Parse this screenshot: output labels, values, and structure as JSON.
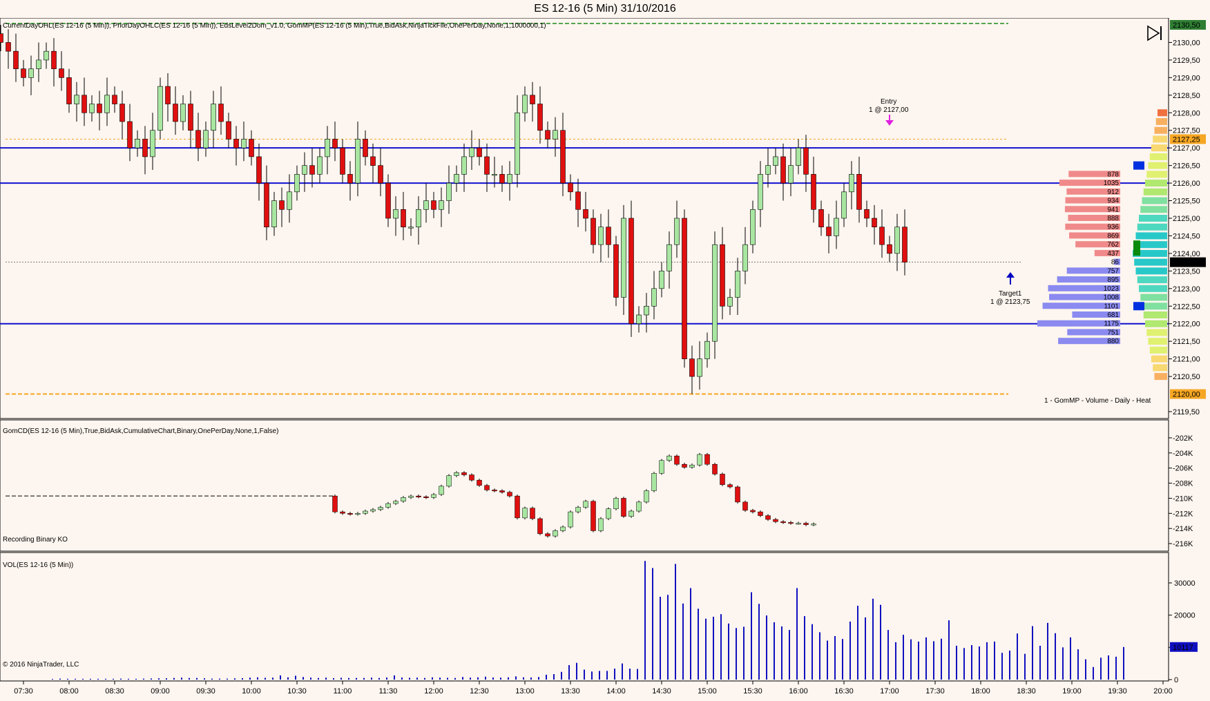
{
  "window": {
    "title": "ES 12-16 (5 Min)  31/10/2016"
  },
  "price_panel": {
    "indicator_label": "CurrentDayOHL(ES 12-16 (5 Min)); PriorDayOHLC(ES 12-16 (5 Min)); EdsLevel2Dom_v1.0; GomMP(ES 12-16 (5 Min),True,BidAsk,NinjaTickFile,OnePerDay,None,1,1000000,1)",
    "profile_label": "1 - GomMP - Volume - Daily - Heat",
    "entry_label": "Entry",
    "entry_detail": "1 @ 2127,00",
    "target_label": "Target1",
    "target_detail": "1 @ 2123,75",
    "y_ticks": [
      "2130,00",
      "2129,50",
      "2129,00",
      "2128,50",
      "2128,00",
      "2127,50",
      "2127,00",
      "2126,50",
      "2126,00",
      "2125,50",
      "2125,00",
      "2124,50",
      "2124,00",
      "2123,50",
      "2123,00",
      "2122,50",
      "2122,00",
      "2121,50",
      "2121,00",
      "2120,50",
      "2119,50"
    ],
    "price_flags": [
      {
        "label": "2130,50",
        "value": 2130.5,
        "color": "#2e7d32",
        "text_color": "#ffffff"
      },
      {
        "label": "2127,25",
        "value": 2127.25,
        "color": "#f5a623",
        "text_color": "#000000"
      },
      {
        "label": "2123,75",
        "value": 2123.75,
        "color": "#000000",
        "text_color": "#ffffff"
      },
      {
        "label": "2120,00",
        "value": 2120.0,
        "color": "#f5a623",
        "text_color": "#000000"
      }
    ],
    "ask_volumes": [
      "878",
      "1035",
      "912",
      "934",
      "941",
      "888",
      "936",
      "869",
      "762",
      "437"
    ],
    "bid_volumes": [
      "86",
      "757",
      "895",
      "1023",
      "1008",
      "1101",
      "681",
      "1175",
      "751",
      "880"
    ]
  },
  "cd_panel": {
    "indicator_label": "GomCD(ES 12-16 (5 Min),True,BidAsk,CumulativeChart,Binary,OnePerDay,None,1,False)",
    "status_label": "Recording Binary KO",
    "y_ticks": [
      "-202K",
      "-204K",
      "-206K",
      "-208K",
      "-210K",
      "-212K",
      "-214K",
      "-216K"
    ]
  },
  "vol_panel": {
    "indicator_label": "VOL(ES 12-16 (5 Min))",
    "copyright": "© 2016 NinjaTrader, LLC",
    "y_ticks": [
      "30000",
      "20000",
      "10000",
      "0"
    ],
    "last_value_label": "10117"
  },
  "x_axis": {
    "labels": [
      "07:30",
      "08:00",
      "08:30",
      "09:00",
      "09:30",
      "10:00",
      "10:30",
      "11:00",
      "11:30",
      "12:00",
      "12:30",
      "13:00",
      "13:30",
      "14:00",
      "14:30",
      "15:00",
      "15:30",
      "16:00",
      "16:30",
      "17:00",
      "17:30",
      "18:00",
      "18:30",
      "19:00",
      "19:30",
      "20:00"
    ]
  },
  "colors": {
    "up": "#a8e6a1",
    "down": "#e01010",
    "level_line": "#1010d0",
    "volume": "#1010c0",
    "background": "#fdf5ef"
  },
  "chart_data": [
    {
      "type": "candlestick",
      "title": "ES 12-16 (5 Min)  31/10/2016",
      "ylim": [
        2119.5,
        2130.5
      ],
      "levels": {
        "blue_lines": [
          2127.0,
          2126.0,
          2122.0
        ],
        "dashed_lines": [
          2127.25,
          2123.75
        ],
        "prior_day_high": 2130.5,
        "current_day_low": 2120.0
      },
      "start_time": "07:15",
      "x_labels": [
        "07:30",
        "08:00",
        "08:30",
        "09:00",
        "09:30",
        "10:00",
        "10:30",
        "11:00",
        "11:30",
        "12:00",
        "12:30",
        "13:00",
        "13:30",
        "14:00",
        "14:30",
        "15:00",
        "15:30",
        "16:00",
        "16:30",
        "17:00",
        "17:30",
        "18:00",
        "18:30",
        "19:00",
        "19:30",
        "20:00"
      ],
      "closes": [
        2130.0,
        2129.75,
        2129.25,
        2129.0,
        2129.25,
        2129.5,
        2129.75,
        2129.25,
        2129.0,
        2128.25,
        2128.5,
        2128.0,
        2128.25,
        2128.0,
        2128.5,
        2128.25,
        2127.75,
        2127.0,
        2127.25,
        2126.75,
        2127.5,
        2128.75,
        2128.25,
        2127.75,
        2128.25,
        2127.5,
        2127.0,
        2127.5,
        2128.25,
        2127.75,
        2127.25,
        2127.0,
        2127.25,
        2126.75,
        2126.0,
        2124.75,
        2125.5,
        2125.25,
        2125.75,
        2126.25,
        2126.5,
        2126.25,
        2126.75,
        2127.25,
        2127.0,
        2126.25,
        2126.0,
        2127.25,
        2126.75,
        2126.5,
        2126.0,
        2125.0,
        2125.25,
        2124.75,
        2124.75,
        2125.25,
        2125.5,
        2125.25,
        2125.5,
        2126.0,
        2126.25,
        2126.75,
        2127.0,
        2126.75,
        2126.25,
        2126.25,
        2126.0,
        2126.25,
        2128.0,
        2128.5,
        2128.25,
        2127.5,
        2127.25,
        2127.5,
        2126.0,
        2125.75,
        2125.25,
        2125.0,
        2124.25,
        2124.75,
        2124.25,
        2122.75,
        2125.0,
        2122.0,
        2122.25,
        2122.5,
        2123.0,
        2123.5,
        2124.25,
        2125.0,
        2121.0,
        2120.5,
        2121.0,
        2121.5,
        2124.25,
        2122.5,
        2122.75,
        2123.5,
        2124.25,
        2125.25,
        2126.25,
        2126.5,
        2126.75,
        2126.0,
        2126.5,
        2127.0,
        2126.25,
        2125.25,
        2124.75,
        2124.5,
        2125.0,
        2125.75,
        2126.25,
        2125.25,
        2125.0,
        2124.75,
        2124.25,
        2124.0,
        2124.75,
        2123.75
      ]
    },
    {
      "type": "candlestick",
      "title": "GomCD(ES 12-16 (5 Min),True,BidAsk,CumulativeChart,Binary,OnePerDay,None,1,False)",
      "ylim": [
        -217,
        -201
      ],
      "y_unit": "K",
      "flat_before_index": 44,
      "closes": [
        -211.8,
        -212.0,
        -212.1,
        -212.0,
        -211.7,
        -211.5,
        -211.2,
        -210.7,
        -210.4,
        -209.9,
        -209.7,
        -209.8,
        -209.9,
        -209.5,
        -208.4,
        -207.0,
        -206.6,
        -206.9,
        -207.6,
        -208.3,
        -208.9,
        -209.0,
        -209.2,
        -209.7,
        -212.6,
        -211.3,
        -212.7,
        -214.7,
        -215.0,
        -214.3,
        -213.8,
        -211.8,
        -211.2,
        -210.4,
        -214.3,
        -212.7,
        -211.4,
        -210.0,
        -212.4,
        -211.7,
        -210.5,
        -209.0,
        -206.7,
        -205.0,
        -204.4,
        -205.5,
        -205.9,
        -205.6,
        -204.2,
        -205.5,
        -206.8,
        -208.2,
        -208.5,
        -210.5,
        -211.6,
        -211.8,
        -212.3,
        -212.8,
        -213.1,
        -213.2,
        -213.3,
        -213.3,
        -213.5,
        -213.4
      ]
    },
    {
      "type": "bar",
      "title": "VOL(ES 12-16 (5 Min))",
      "ylim": [
        0,
        36000
      ],
      "values": [
        200,
        300,
        250,
        250,
        250,
        250,
        250,
        250,
        250,
        300,
        250,
        250,
        300,
        350,
        400,
        400,
        500,
        600,
        500,
        500,
        400,
        300,
        300,
        300,
        400,
        450,
        600,
        700,
        550,
        600,
        1300,
        700,
        1200,
        800,
        600,
        500,
        600,
        450,
        550,
        500,
        500,
        500,
        600,
        500,
        650,
        1300,
        650,
        550,
        600,
        500,
        700,
        600,
        550,
        500,
        800,
        600,
        700,
        900,
        650,
        600,
        700,
        1000,
        700,
        650,
        800,
        1500,
        1700,
        2400,
        4500,
        5200,
        3100,
        2500,
        2700,
        2700,
        3400,
        5000,
        3400,
        3300,
        36800,
        34600,
        25700,
        26300,
        35900,
        23600,
        28400,
        22000,
        18900,
        19500,
        20300,
        17400,
        16000,
        16400,
        27100,
        23500,
        19900,
        17800,
        16500,
        15400,
        28400,
        19700,
        17200,
        14700,
        12100,
        13500,
        12600,
        18000,
        22900,
        19300,
        25100,
        23200,
        15400,
        11600,
        13900,
        12500,
        11800,
        13100,
        11900,
        12700,
        18400,
        10500,
        9800,
        10700,
        10300,
        11600,
        11800,
        8300,
        9000,
        14300,
        8000,
        16600,
        10500,
        17600,
        14400,
        10000,
        13100,
        9400,
        6300,
        3900,
        6800,
        7500,
        7100,
        10117
      ]
    }
  ]
}
